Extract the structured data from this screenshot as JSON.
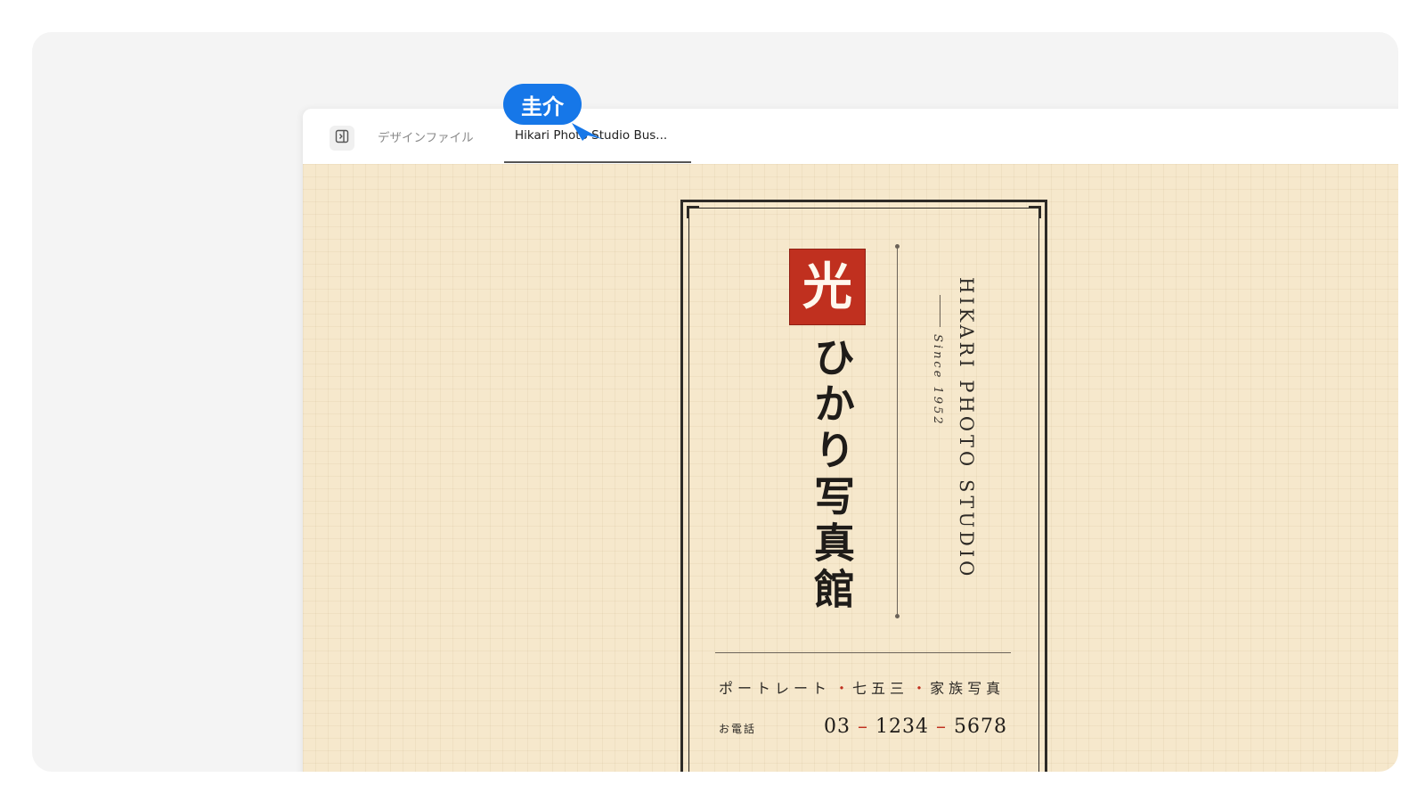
{
  "tabs": {
    "design_files_label": "デザインファイル",
    "active_tab_label": "Hikari Photo Studio Bus..."
  },
  "collaborator": {
    "name": "圭介",
    "color": "#1677e8"
  },
  "card": {
    "seal_char": "光",
    "japanese_name": "ひかり写真館",
    "english_name": "HIKARI PHOTO STUDIO",
    "since": "Since 1952",
    "services": [
      "ポートレート",
      "七五三",
      "家族写真"
    ],
    "service_separator": "・",
    "phone_label": "お電話",
    "phone_parts": [
      "03",
      "1234",
      "5678"
    ],
    "phone_separator": "–",
    "accent_color": "#c0301f",
    "paper_color": "#f6e8cc",
    "ink_color": "#2d2a26"
  },
  "icons": {
    "sidebar_toggle": "sidebar-toggle-icon"
  }
}
